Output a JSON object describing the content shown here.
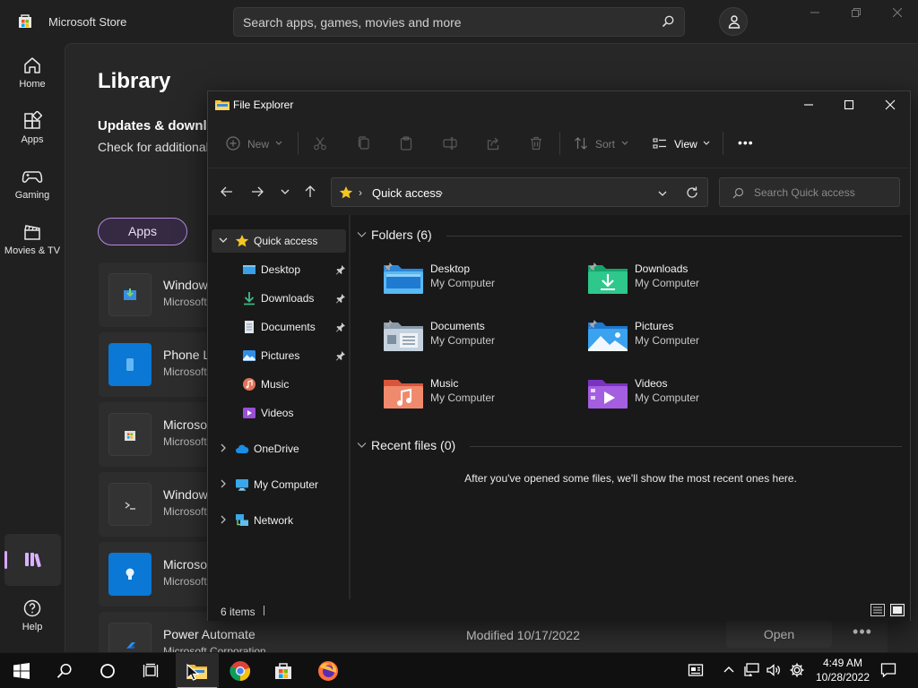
{
  "store": {
    "title": "Microsoft Store",
    "search_placeholder": "Search apps, games, movies and more",
    "nav": [
      {
        "label": "Home",
        "icon": "home-icon"
      },
      {
        "label": "Apps",
        "icon": "apps-grid-icon"
      },
      {
        "label": "Gaming",
        "icon": "gamepad-icon"
      },
      {
        "label": "Movies & TV",
        "icon": "clapperboard-icon"
      }
    ],
    "library_icon": "library-icon",
    "help_label": "Help",
    "library": {
      "title": "Library",
      "updates_title": "Updates & downlo",
      "updates_subtitle": "Check for additional",
      "filter_apps": "Apps",
      "apps": [
        {
          "name": "Window",
          "publisher": "Microsoft"
        },
        {
          "name": "Phone L",
          "publisher": "Microsoft"
        },
        {
          "name": "Microso",
          "publisher": "Microsoft"
        },
        {
          "name": "Window",
          "publisher": "Microsoft"
        },
        {
          "name": "Microso",
          "publisher": "Microsoft"
        },
        {
          "name": "Power Automate",
          "publisher": "Microsoft Corporation",
          "modified": "Modified 10/17/2022",
          "action": "Open",
          "more": "•••"
        }
      ]
    }
  },
  "explorer": {
    "title": "File Explorer",
    "commands": {
      "new": "New",
      "sort": "Sort",
      "view": "View",
      "more": "•••"
    },
    "address": {
      "chevron": "›",
      "location": "Quick access"
    },
    "search_placeholder": "Search Quick access",
    "nav_tree": {
      "quick_access": "Quick access",
      "pinned": [
        {
          "label": "Desktop",
          "pinned": true
        },
        {
          "label": "Downloads",
          "pinned": true
        },
        {
          "label": "Documents",
          "pinned": true
        },
        {
          "label": "Pictures",
          "pinned": true
        },
        {
          "label": "Music",
          "pinned": false
        },
        {
          "label": "Videos",
          "pinned": false
        }
      ],
      "onedrive": "OneDrive",
      "my_computer": "My Computer",
      "network": "Network"
    },
    "folders_header": "Folders (6)",
    "folders": [
      {
        "name": "Desktop",
        "location": "My Computer",
        "pinned": true
      },
      {
        "name": "Downloads",
        "location": "My Computer",
        "pinned": true
      },
      {
        "name": "Documents",
        "location": "My Computer",
        "pinned": true
      },
      {
        "name": "Pictures",
        "location": "My Computer",
        "pinned": true
      },
      {
        "name": "Music",
        "location": "My Computer",
        "pinned": false
      },
      {
        "name": "Videos",
        "location": "My Computer",
        "pinned": false
      }
    ],
    "recent_header": "Recent files (0)",
    "recent_empty": "After you've opened some files, we'll show the most recent ones here.",
    "status_items": "6 items"
  },
  "taskbar": {
    "time": "4:49 AM",
    "date": "10/28/2022"
  }
}
